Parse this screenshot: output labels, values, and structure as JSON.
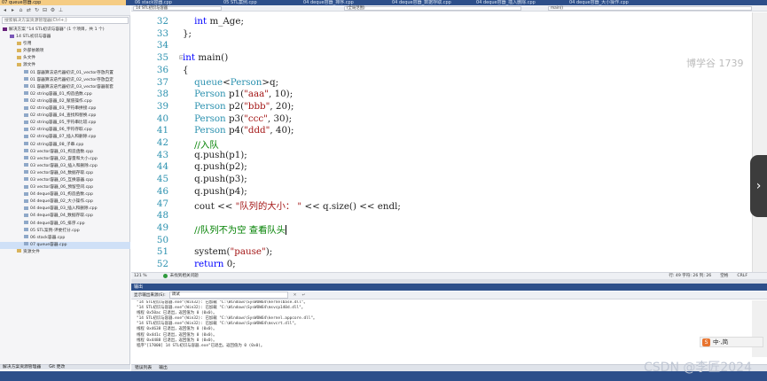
{
  "tabs": [
    {
      "label": "07 queue容器.cpp",
      "active": true
    },
    {
      "label": "06 stack容器.cpp",
      "active": false
    },
    {
      "label": "05 STL案例.cpp",
      "active": false
    },
    {
      "label": "04 deque容器_排序.cpp",
      "active": false
    },
    {
      "label": "04 deque容器_数据存取.cpp",
      "active": false
    },
    {
      "label": "04 deque容器_插入删除.cpp",
      "active": false
    },
    {
      "label": "04 deque容器_大小操作.cpp",
      "active": false
    }
  ],
  "sidebar": {
    "search_placeholder": "搜索解决方案资源管理器(Ctrl+;)",
    "toolbar_icons": [
      "back-icon",
      "forward-icon",
      "home-icon",
      "sync-icon",
      "refresh-icon",
      "collapse-icon",
      "settings-icon",
      "pin-icon"
    ],
    "tree": [
      {
        "label": "解决方案 \"14 STL初识与容器\" (1 个项目，共 1 个)",
        "level": 0,
        "kind": "solution"
      },
      {
        "label": "14 STL初识与容器",
        "level": 1,
        "kind": "project"
      },
      {
        "label": "引用",
        "level": 2,
        "kind": "folder"
      },
      {
        "label": "外部依赖项",
        "level": 2,
        "kind": "folder"
      },
      {
        "label": "头文件",
        "level": 2,
        "kind": "folder"
      },
      {
        "label": "源文件",
        "level": 2,
        "kind": "folder"
      },
      {
        "label": "01 容器算法迭代器初识_01_vector存放内置",
        "level": 3,
        "kind": "file"
      },
      {
        "label": "01 容器算法迭代器初识_02_vector存放自定",
        "level": 3,
        "kind": "file"
      },
      {
        "label": "01 容器算法迭代器初识_03_vector容器嵌套",
        "level": 3,
        "kind": "file"
      },
      {
        "label": "02 string容器_01_构造函数.cpp",
        "level": 3,
        "kind": "file"
      },
      {
        "label": "02 string容器_02_赋值操作.cpp",
        "level": 3,
        "kind": "file"
      },
      {
        "label": "02 string容器_03_字符串拼接.cpp",
        "level": 3,
        "kind": "file"
      },
      {
        "label": "02 string容器_04_查找和替换.cpp",
        "level": 3,
        "kind": "file"
      },
      {
        "label": "02 string容器_05_字符串比较.cpp",
        "level": 3,
        "kind": "file"
      },
      {
        "label": "02 string容器_06_字符存取.cpp",
        "level": 3,
        "kind": "file"
      },
      {
        "label": "02 string容器_07_插入和删除.cpp",
        "level": 3,
        "kind": "file"
      },
      {
        "label": "02 string容器_08_子串.cpp",
        "level": 3,
        "kind": "file"
      },
      {
        "label": "03 vector容器_01_构造函数.cpp",
        "level": 3,
        "kind": "file"
      },
      {
        "label": "03 vector容器_02_容量和大小.cpp",
        "level": 3,
        "kind": "file"
      },
      {
        "label": "03 vector容器_03_插入和删除.cpp",
        "level": 3,
        "kind": "file"
      },
      {
        "label": "03 vector容器_04_数据存取.cpp",
        "level": 3,
        "kind": "file"
      },
      {
        "label": "03 vector容器_05_互换容器.cpp",
        "level": 3,
        "kind": "file"
      },
      {
        "label": "03 vector容器_06_预留空间.cpp",
        "level": 3,
        "kind": "file"
      },
      {
        "label": "04 deque容器_01_构造函数.cpp",
        "level": 3,
        "kind": "file"
      },
      {
        "label": "04 deque容器_02_大小操作.cpp",
        "level": 3,
        "kind": "file"
      },
      {
        "label": "04 deque容器_03_插入和删除.cpp",
        "level": 3,
        "kind": "file"
      },
      {
        "label": "04 deque容器_04_数据存取.cpp",
        "level": 3,
        "kind": "file"
      },
      {
        "label": "04 deque容器_05_排序.cpp",
        "level": 3,
        "kind": "file"
      },
      {
        "label": "05 STL案例-评委打分.cpp",
        "level": 3,
        "kind": "file"
      },
      {
        "label": "06 stack容器.cpp",
        "level": 3,
        "kind": "file"
      },
      {
        "label": "07 queue容器.cpp",
        "level": 3,
        "kind": "file"
      },
      {
        "label": "资源文件",
        "level": 2,
        "kind": "folder"
      }
    ],
    "bottom_tabs": [
      "解决方案资源管理器",
      "Git 更改"
    ]
  },
  "editor": {
    "project_combo": "14 STL初识与容器",
    "scope_combo": "(全局范围)",
    "function_combo": "main()",
    "watermark": "博学谷 1739",
    "current_line": 49,
    "lines": [
      {
        "n": "32",
        "segs": [
          {
            "t": "    int ",
            "c": "kw"
          },
          {
            "t": "m_Age;",
            "c": ""
          }
        ]
      },
      {
        "n": "33",
        "segs": [
          {
            "t": "};",
            "c": ""
          }
        ]
      },
      {
        "n": "34",
        "segs": []
      },
      {
        "n": "35",
        "segs": [
          {
            "t": "int ",
            "c": "kw"
          },
          {
            "t": "main()",
            "c": ""
          }
        ]
      },
      {
        "n": "36",
        "segs": [
          {
            "t": "{",
            "c": ""
          }
        ]
      },
      {
        "n": "37",
        "segs": [
          {
            "t": "    queue",
            "c": "ty"
          },
          {
            "t": "<",
            "c": ""
          },
          {
            "t": "Person",
            "c": "ty"
          },
          {
            "t": ">q;",
            "c": ""
          }
        ]
      },
      {
        "n": "38",
        "segs": [
          {
            "t": "    Person ",
            "c": "ty"
          },
          {
            "t": "p1(",
            "c": ""
          },
          {
            "t": "\"aaa\"",
            "c": "st"
          },
          {
            "t": ", 10);",
            "c": ""
          }
        ]
      },
      {
        "n": "39",
        "segs": [
          {
            "t": "    Person ",
            "c": "ty"
          },
          {
            "t": "p2(",
            "c": ""
          },
          {
            "t": "\"bbb\"",
            "c": "st"
          },
          {
            "t": ", 20);",
            "c": ""
          }
        ]
      },
      {
        "n": "40",
        "segs": [
          {
            "t": "    Person ",
            "c": "ty"
          },
          {
            "t": "p3(",
            "c": ""
          },
          {
            "t": "\"ccc\"",
            "c": "st"
          },
          {
            "t": ", 30);",
            "c": ""
          }
        ]
      },
      {
        "n": "41",
        "segs": [
          {
            "t": "    Person ",
            "c": "ty"
          },
          {
            "t": "p4(",
            "c": ""
          },
          {
            "t": "\"ddd\"",
            "c": "st"
          },
          {
            "t": ", 40);",
            "c": ""
          }
        ]
      },
      {
        "n": "42",
        "segs": [
          {
            "t": "    //入队",
            "c": "cm"
          }
        ]
      },
      {
        "n": "43",
        "segs": [
          {
            "t": "    q.push(p1);",
            "c": ""
          }
        ]
      },
      {
        "n": "44",
        "segs": [
          {
            "t": "    q.push(p2);",
            "c": ""
          }
        ]
      },
      {
        "n": "45",
        "segs": [
          {
            "t": "    q.push(p3);",
            "c": ""
          }
        ]
      },
      {
        "n": "46",
        "segs": [
          {
            "t": "    q.push(p4);",
            "c": ""
          }
        ]
      },
      {
        "n": "47",
        "segs": [
          {
            "t": "    cout << ",
            "c": ""
          },
          {
            "t": "\"队列的大小： \"",
            "c": "st"
          },
          {
            "t": " << q.size() << endl;",
            "c": ""
          }
        ]
      },
      {
        "n": "48",
        "segs": []
      },
      {
        "n": "49",
        "segs": [
          {
            "t": "    //队列不为空 查看队头",
            "c": "cm"
          }
        ]
      },
      {
        "n": "50",
        "segs": []
      },
      {
        "n": "51",
        "segs": [
          {
            "t": "    system(",
            "c": ""
          },
          {
            "t": "\"pause\"",
            "c": "st"
          },
          {
            "t": ");",
            "c": ""
          }
        ]
      },
      {
        "n": "52",
        "segs": [
          {
            "t": "    return ",
            "c": "kw"
          },
          {
            "t": "0;",
            "c": ""
          }
        ]
      }
    ]
  },
  "editor_status": {
    "zoom": "121 %",
    "issues": "未找到相关问题",
    "line_col": "行: 49  字符: 26  列: 26",
    "whitespace": "空格",
    "eol": "CRLF"
  },
  "output": {
    "title": "输出",
    "source_label": "显示输出来源(S):",
    "source_value": "调试",
    "lines": [
      "\"14 STL初识与容器.exe\"(Win32): 已加载 \"C:\\Windows\\SysWOW64\\kernelbase.dll\"。",
      "\"14 STL初识与容器.exe\"(Win32): 已加载 \"C:\\Windows\\SysWOW64\\msvcp140d.dll\"。",
      "线程 0x50ac 已退出，返回值为 0 (0x0)。",
      "\"14 STL初识与容器.exe\"(Win32): 已加载 \"C:\\Windows\\SysWOW64\\kernel.appcore.dll\"。",
      "\"14 STL初识与容器.exe\"(Win32): 已加载 \"C:\\Windows\\SysWOW64\\msvcrt.dll\"。",
      "线程 0x4638 已退出，返回值为 0 (0x0)。",
      "线程 0x4d1c 已退出，返回值为 0 (0x0)。",
      "线程 0x4488 已退出，返回值为 0 (0x0)。",
      "程序\"[17000] 14 STL初识与容器.exe\"已退出，返回值为 0 (0x0)。"
    ],
    "tabs": [
      "错误列表",
      "输出"
    ]
  },
  "ime": {
    "label": "中·,简"
  },
  "watermark": "CSDN @李匠2024"
}
